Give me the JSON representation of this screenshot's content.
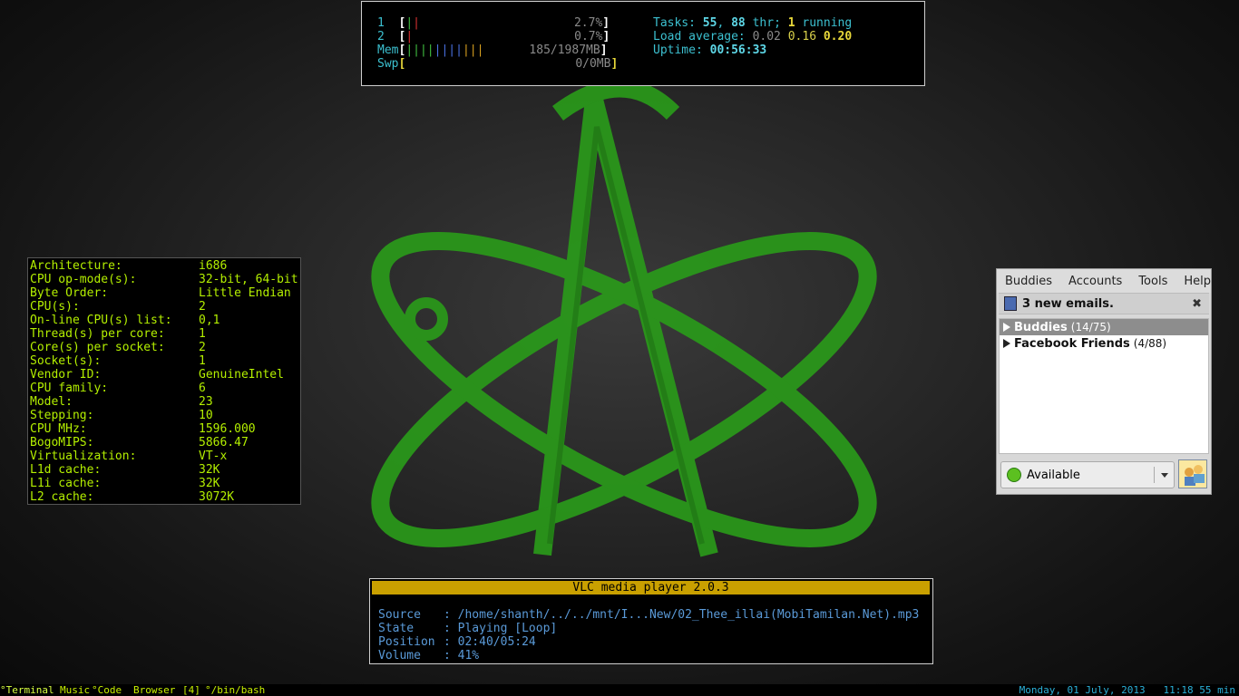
{
  "htop": {
    "cpu1_num": "1",
    "cpu1_pct": "2.7%",
    "cpu2_num": "2",
    "cpu2_pct": "0.7%",
    "mem_label": "Mem",
    "mem_value": "185/1987MB",
    "swp_label": "Swp",
    "swp_value": "0/0MB",
    "tasks_label": "Tasks:",
    "tasks_count": "55",
    "tasks_sep": ",",
    "threads_count": "88",
    "threads_label": "thr;",
    "running_count": "1",
    "running_label": "running",
    "load_label": "Load average:",
    "load_1": "0.02",
    "load_5": "0.16",
    "load_15": "0.20",
    "uptime_label": "Uptime:",
    "uptime_value": "00:56:33"
  },
  "lscpu": {
    "rows": [
      {
        "key": "Architecture:",
        "value": "i686"
      },
      {
        "key": "CPU op-mode(s):",
        "value": "32-bit, 64-bit"
      },
      {
        "key": "Byte Order:",
        "value": "Little Endian"
      },
      {
        "key": "CPU(s):",
        "value": "2"
      },
      {
        "key": "On-line CPU(s) list:",
        "value": "0,1"
      },
      {
        "key": "Thread(s) per core:",
        "value": "1"
      },
      {
        "key": "Core(s) per socket:",
        "value": "2"
      },
      {
        "key": "Socket(s):",
        "value": "1"
      },
      {
        "key": "Vendor ID:",
        "value": "GenuineIntel"
      },
      {
        "key": "CPU family:",
        "value": "6"
      },
      {
        "key": "Model:",
        "value": "23"
      },
      {
        "key": "Stepping:",
        "value": "10"
      },
      {
        "key": "CPU MHz:",
        "value": "1596.000"
      },
      {
        "key": "BogoMIPS:",
        "value": "5866.47"
      },
      {
        "key": "Virtualization:",
        "value": "VT-x"
      },
      {
        "key": "L1d cache:",
        "value": "32K"
      },
      {
        "key": "L1i cache:",
        "value": "32K"
      },
      {
        "key": "L2 cache:",
        "value": "3072K"
      }
    ]
  },
  "pidgin": {
    "menu": [
      "Buddies",
      "Accounts",
      "Tools",
      "Help"
    ],
    "notification": "3 new emails.",
    "close_glyph": "✖",
    "groups": [
      {
        "name": "Buddies",
        "count": "(14/75)"
      },
      {
        "name": "Facebook Friends",
        "count": "(4/88)"
      }
    ],
    "status": "Available"
  },
  "vlc": {
    "title": "VLC media player 2.0.3",
    "source_key": "Source",
    "source_value": ": /home/shanth/../../mnt/I...New/02_Thee_illai(MobiTamilan.Net).mp3",
    "state_key": "State",
    "state_value": ": Playing [Loop]",
    "position_key": "Position",
    "position_value": ": 02:40/05:24",
    "volume_key": "Volume",
    "volume_value": ": 41%"
  },
  "taskbar": {
    "workspaces": [
      "°Terminal",
      "Music",
      "°Code",
      "Browser"
    ],
    "window_count": "[4]",
    "active_window": "°/bin/bash",
    "clock": "Monday, 01 July, 2013   11:18 55 min"
  },
  "icons": {
    "wallpaper_symbol": "atom-icon",
    "mail": "mail-icon",
    "status_dot": "available-status-icon",
    "avatar": "buddy-icon"
  },
  "colors": {
    "wallpaper_green": "#2fa81e",
    "terminal_green": "#b4f000",
    "vlc_title": "#c9a000",
    "htop_cyan": "#3cc0d0"
  }
}
